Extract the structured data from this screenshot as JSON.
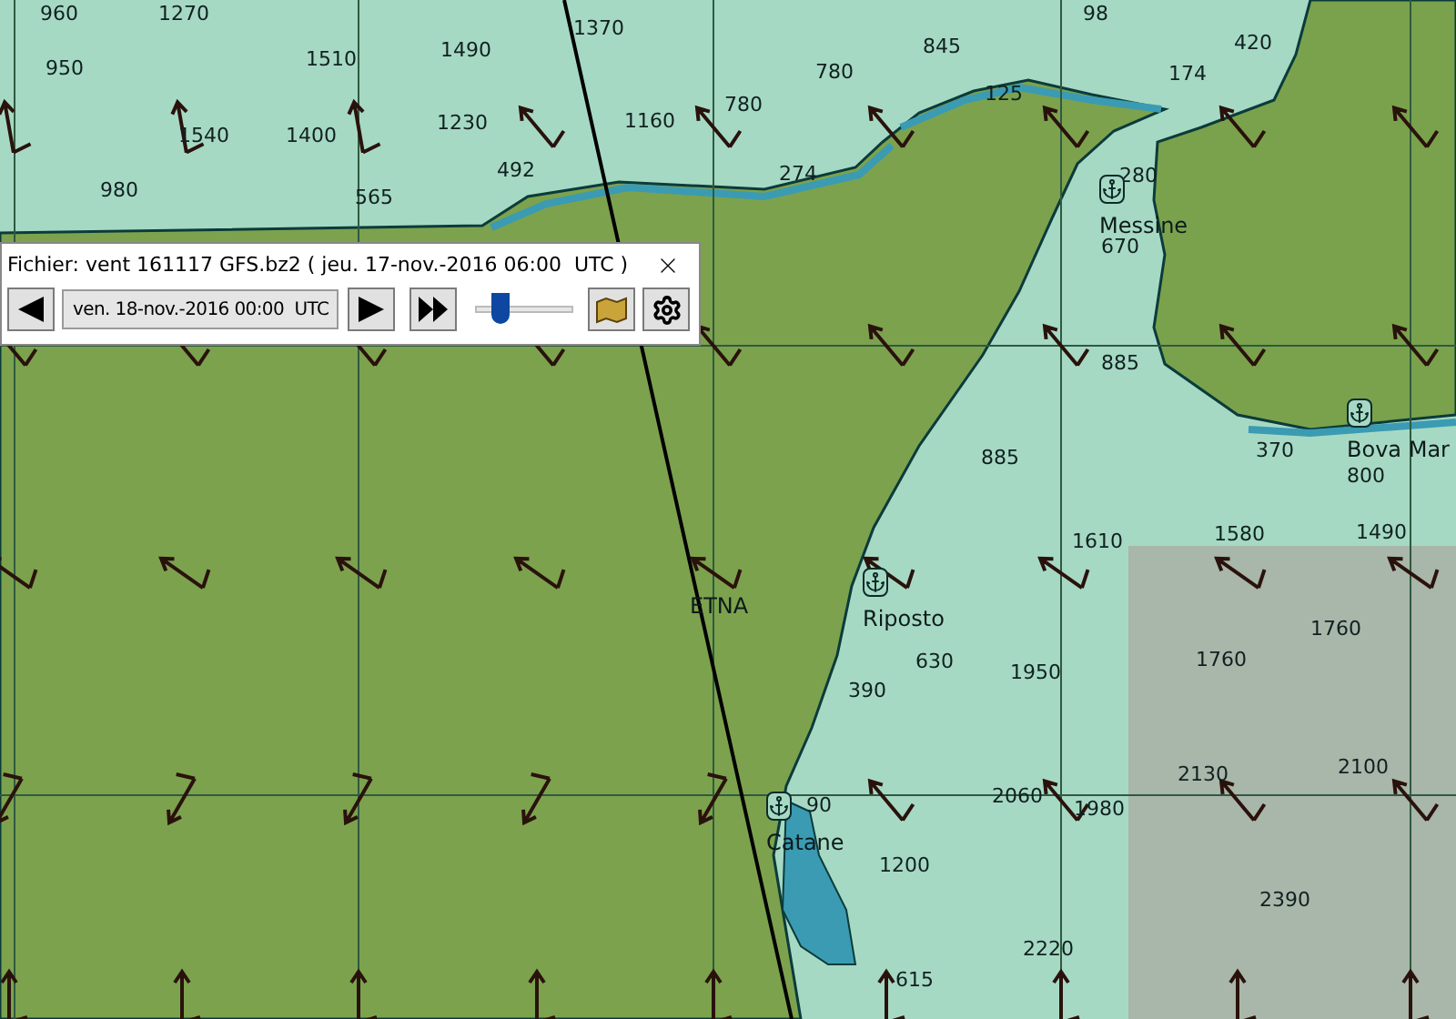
{
  "toolbar": {
    "file_title": "Fichier: vent 161117 GFS.bz2 ( jeu. 17-nov.-2016 06:00  UTC )",
    "time_select": {
      "value": "ven. 18-nov.-2016 00:00  UTC"
    },
    "timeline": {
      "level": 0.2
    }
  },
  "map": {
    "labels": [
      {
        "text": "960",
        "kind": "sounding"
      },
      {
        "text": "1270",
        "kind": "sounding"
      },
      {
        "text": "1370",
        "kind": "sounding"
      },
      {
        "text": "845",
        "kind": "sounding"
      },
      {
        "text": "98",
        "kind": "sounding"
      },
      {
        "text": "420",
        "kind": "sounding"
      },
      {
        "text": "950",
        "kind": "sounding"
      },
      {
        "text": "1510",
        "kind": "sounding"
      },
      {
        "text": "1490",
        "kind": "sounding"
      },
      {
        "text": "780",
        "kind": "sounding"
      },
      {
        "text": "125",
        "kind": "sounding"
      },
      {
        "text": "174",
        "kind": "sounding"
      },
      {
        "text": "780",
        "kind": "sounding"
      },
      {
        "text": "1540",
        "kind": "sounding"
      },
      {
        "text": "1400",
        "kind": "sounding"
      },
      {
        "text": "1230",
        "kind": "sounding"
      },
      {
        "text": "1160",
        "kind": "sounding"
      },
      {
        "text": "492",
        "kind": "sounding"
      },
      {
        "text": "274",
        "kind": "sounding"
      },
      {
        "text": "980",
        "kind": "sounding"
      },
      {
        "text": "565",
        "kind": "sounding"
      },
      {
        "text": "280",
        "kind": "sounding"
      },
      {
        "text": "Messine",
        "kind": "place",
        "harbour": true
      },
      {
        "text": "670",
        "kind": "sounding"
      },
      {
        "text": "885",
        "kind": "sounding"
      },
      {
        "text": "885",
        "kind": "sounding"
      },
      {
        "text": "370",
        "kind": "sounding"
      },
      {
        "text": "Bova Mar",
        "kind": "place",
        "harbour": true
      },
      {
        "text": "800",
        "kind": "sounding"
      },
      {
        "text": "1610",
        "kind": "sounding"
      },
      {
        "text": "1580",
        "kind": "sounding"
      },
      {
        "text": "1490",
        "kind": "sounding"
      },
      {
        "text": "ETNA",
        "kind": "place",
        "harbour": false
      },
      {
        "text": "Riposto",
        "kind": "place",
        "harbour": true
      },
      {
        "text": "1760",
        "kind": "sounding"
      },
      {
        "text": "630",
        "kind": "sounding"
      },
      {
        "text": "1760",
        "kind": "sounding"
      },
      {
        "text": "1950",
        "kind": "sounding"
      },
      {
        "text": "390",
        "kind": "sounding"
      },
      {
        "text": "2130",
        "kind": "sounding"
      },
      {
        "text": "2100",
        "kind": "sounding"
      },
      {
        "text": "2060",
        "kind": "sounding"
      },
      {
        "text": "90",
        "kind": "sounding"
      },
      {
        "text": "1980",
        "kind": "sounding"
      },
      {
        "text": "Catane",
        "kind": "place",
        "harbour": true
      },
      {
        "text": "1200",
        "kind": "sounding"
      },
      {
        "text": "2390",
        "kind": "sounding"
      },
      {
        "text": "2220",
        "kind": "sounding"
      },
      {
        "text": "615",
        "kind": "sounding"
      }
    ]
  }
}
